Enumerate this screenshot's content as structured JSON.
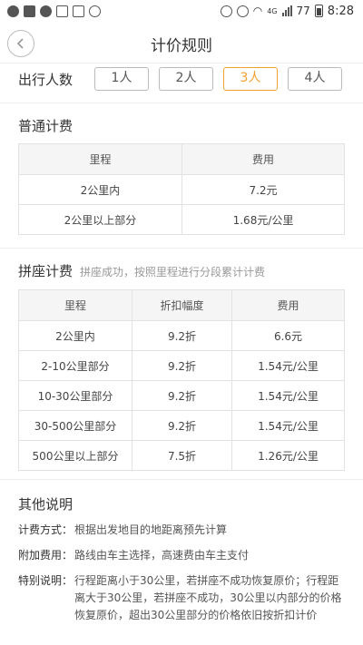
{
  "status_bar": {
    "battery": "77",
    "time": "8:28",
    "network": "4G"
  },
  "header": {
    "title": "计价规则"
  },
  "people": {
    "label": "出行人数",
    "options": [
      "1人",
      "2人",
      "3人",
      "4人"
    ],
    "selected_index": 2
  },
  "normal": {
    "title": "普通计费",
    "columns": [
      "里程",
      "费用"
    ],
    "rows": [
      [
        "2公里内",
        "7.2元"
      ],
      [
        "2公里以上部分",
        "1.68元/公里"
      ]
    ]
  },
  "carpool": {
    "title": "拼座计费",
    "subtitle": "拼座成功，按照里程进行分段累计计费",
    "columns": [
      "里程",
      "折扣幅度",
      "费用"
    ],
    "rows": [
      [
        "2公里内",
        "9.2折",
        "6.6元"
      ],
      [
        "2-10公里部分",
        "9.2折",
        "1.54元/公里"
      ],
      [
        "10-30公里部分",
        "9.2折",
        "1.54元/公里"
      ],
      [
        "30-500公里部分",
        "9.2折",
        "1.54元/公里"
      ],
      [
        "500公里以上部分",
        "7.5折",
        "1.26元/公里"
      ]
    ]
  },
  "other": {
    "title": "其他说明",
    "items": [
      {
        "label": "计费方式：",
        "text": "根据出发地目的地距离预先计算"
      },
      {
        "label": "附加费用：",
        "text": "路线由车主选择，高速费由车主支付"
      },
      {
        "label": "特别说明：",
        "text": "行程距离小于30公里，若拼座不成功恢复原价；行程距离大于30公里，若拼座不成功，30公里以内部分的价格恢复原价，超出30公里部分的价格依旧按折扣计价"
      }
    ]
  },
  "colors": {
    "accent": "#f0a030",
    "border": "#e2e2e2",
    "header_bg": "#f5f5f5"
  }
}
